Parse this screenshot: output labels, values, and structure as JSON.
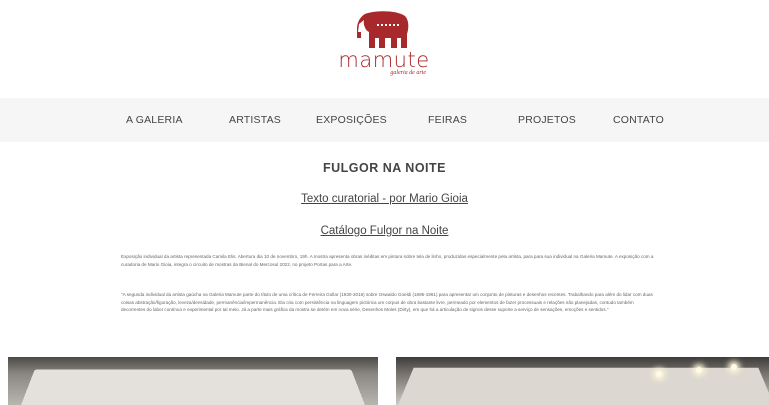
{
  "brand": {
    "name": "mamute",
    "subtitle": "galeria de arte",
    "logo_color": "#a8292b"
  },
  "nav": {
    "items": [
      {
        "label": "A GALERIA"
      },
      {
        "label": "ARTISTAS"
      },
      {
        "label": "EXPOSIÇÕES"
      },
      {
        "label": "FEIRAS"
      },
      {
        "label": "PROJETOS"
      },
      {
        "label": "CONTATO"
      }
    ]
  },
  "main": {
    "title": "FULGOR NA NOITE",
    "link_curatorial": "Texto curatorial - por Mario Gioia",
    "link_catalog": "Catálogo Fulgor na Noite",
    "paragraph1": "Exposição individual da artista representada Camila Elis. Abertura dia 10 de novembro, 19h. A mostra apresenta obras inéditas em pintura sobre tela de linho, produzidas especialmente pela artista, para para sua individual na Galeria Mamute. A exposição com a curadoria de Mario Gioia, integra o circuito de mostras da Bienal do Mercosul 2022, no projeto Portas para a Arte.",
    "paragraph2": "\"A segunda individual da artista gaúcha na Galeria Mamute parte do título de uma crítica de Ferreira Gullar (1930-2016) sobre Oswaldo Goeldi (1895-1961) para apresentar um conjunto de pinturas e desenhos recentes. Trabalhando para além do lidar com duas coisas abstração/figuração, leveza/densidade, permanência/impermanência. Ela cria com persistência na linguagem pictórica um corpus de obra bastante livre, permeado por elementos de fazer processuais e relações não planejadas, contudo também decorrentes do labor contínuo e experimental por tal meio. Já a parte mais gráfica da mostra se detém em nova série, Desenhos Moles (Dirty), em que há a articulação de signos desse suporte a serviço de sensações, emoções e sentidos.\""
  }
}
